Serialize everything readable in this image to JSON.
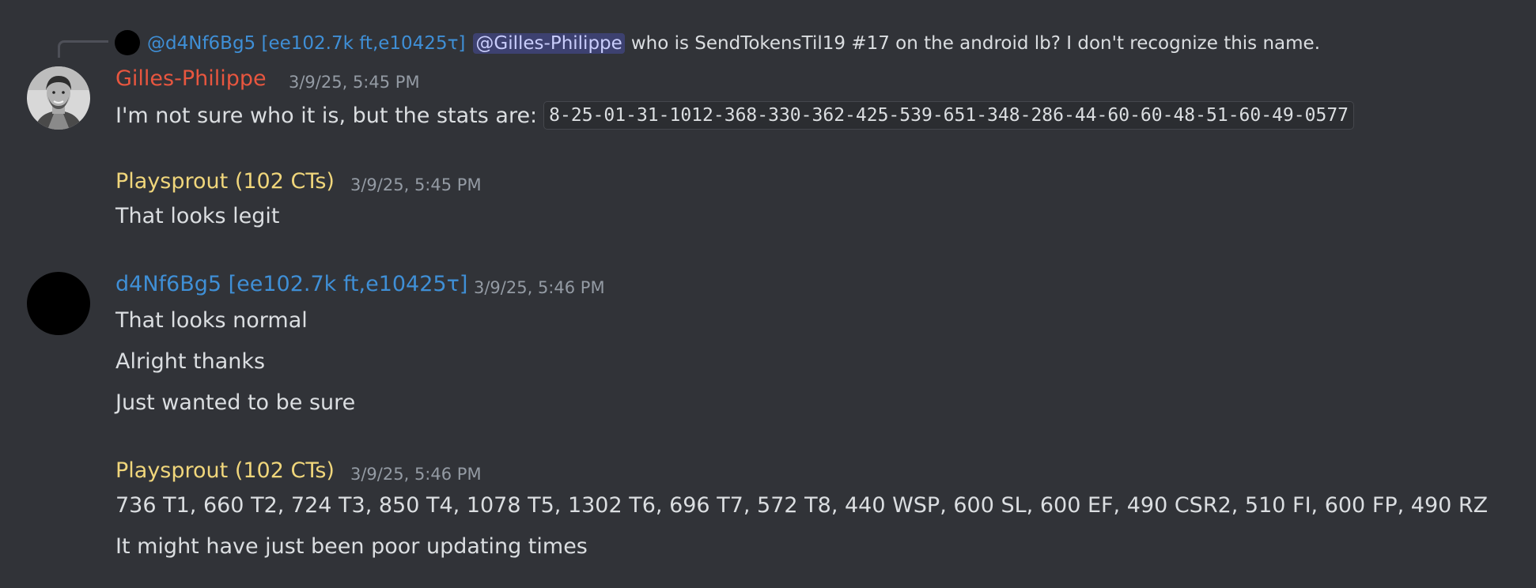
{
  "colors": {
    "background": "#313338",
    "gilles_name": "#e8563f",
    "playsprout_name": "#f0d67b",
    "d4n_name": "#3f8fd6",
    "timestamp": "#949ba4",
    "mention_bg": "#3c4270"
  },
  "reply": {
    "avatar_icon": "black-circle-avatar",
    "author": "@d4Nf6Bg5 [ee102.7k ft,e10425τ]",
    "mention": "@Gilles-Philippe",
    "text": "who is SendTokensTil19 #17 on the android lb? I don't recognize this name."
  },
  "messages": [
    {
      "author": "Gilles-Philippe",
      "timestamp": "3/9/25, 5:45 PM",
      "avatar_icon": "profile-photo-avatar",
      "lines": [
        {
          "text": "I'm not sure who it is, but the stats are:",
          "code": "8-25-01-31-1012-368-330-362-425-539-651-348-286-44-60-60-48-51-60-49-0577"
        }
      ]
    },
    {
      "author": "Playsprout (102 CTs)",
      "timestamp": "3/9/25, 5:45 PM",
      "lines": [
        {
          "text": "That looks legit"
        }
      ]
    },
    {
      "author": "d4Nf6Bg5 [ee102.7k ft,e10425τ]",
      "timestamp": "3/9/25, 5:46 PM",
      "avatar_icon": "black-circle-avatar",
      "lines": [
        {
          "text": "That looks normal"
        },
        {
          "text": "Alright thanks"
        },
        {
          "text": "Just wanted to be sure"
        }
      ]
    },
    {
      "author": "Playsprout (102 CTs)",
      "timestamp": "3/9/25, 5:46 PM",
      "lines": [
        {
          "text": "736 T1, 660 T2, 724 T3, 850 T4, 1078 T5, 1302 T6, 696 T7, 572 T8, 440 WSP, 600 SL, 600 EF, 490 CSR2, 510 FI, 600 FP, 490 RZ"
        },
        {
          "text": "It might have just been poor updating times"
        }
      ]
    }
  ]
}
